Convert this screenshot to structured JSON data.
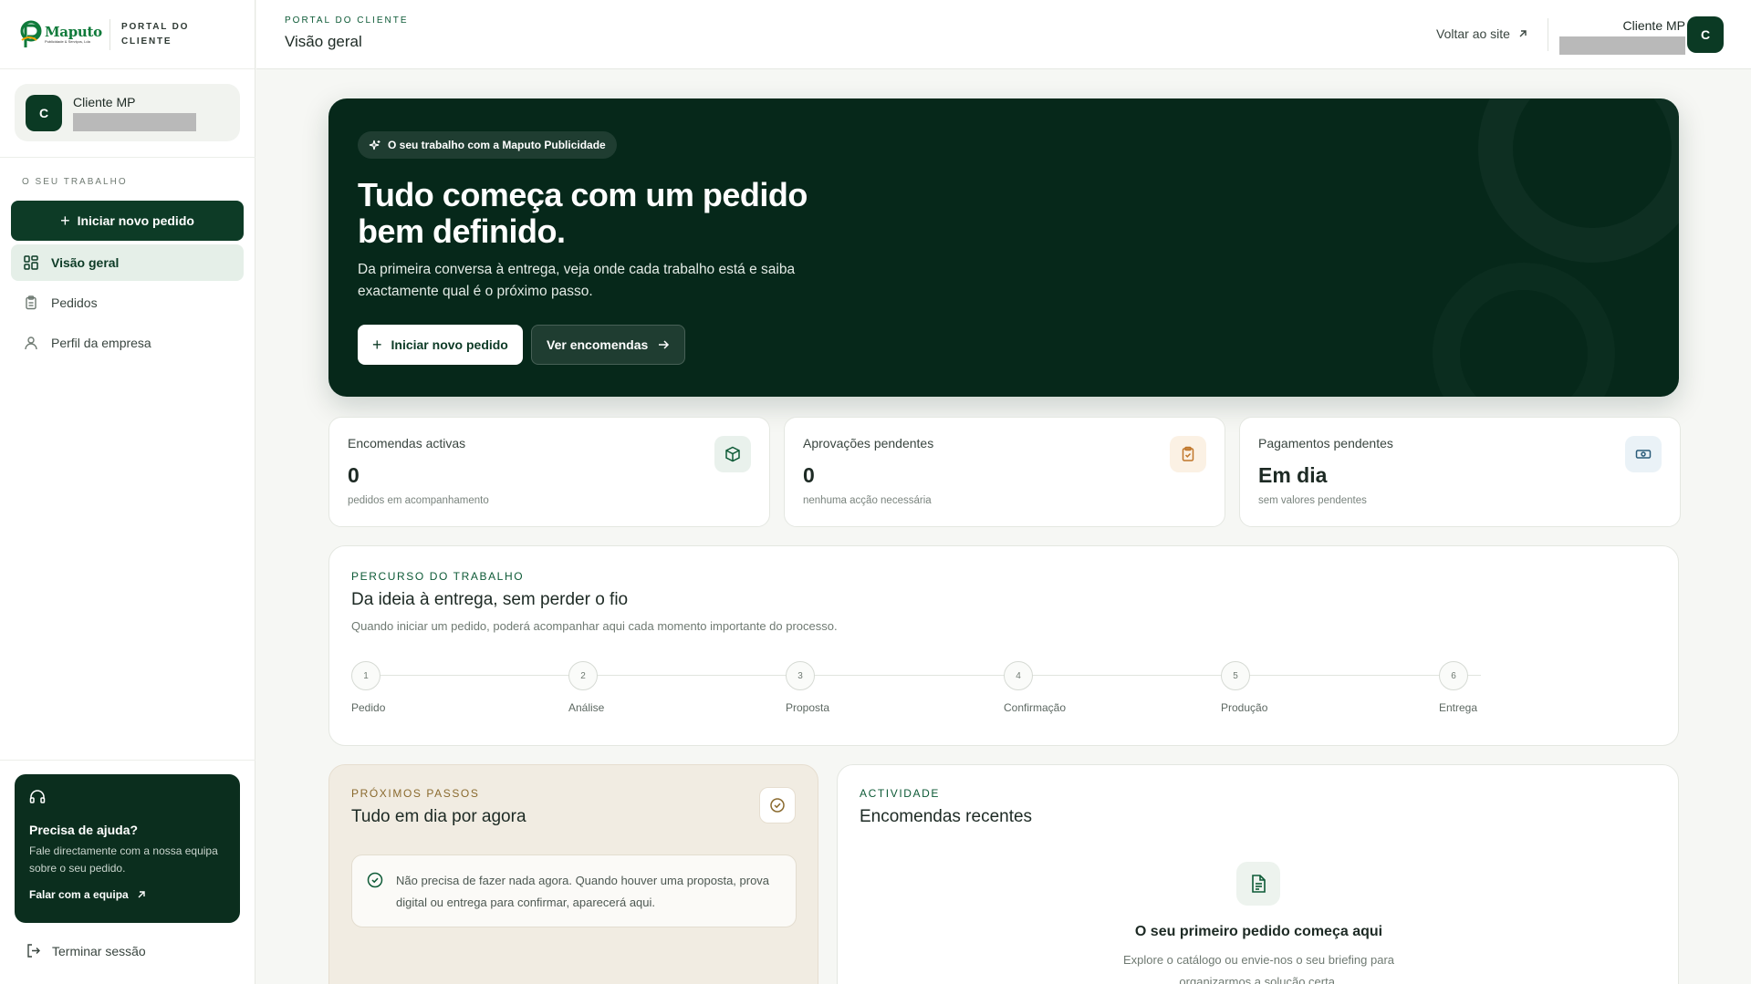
{
  "brand": {
    "logo_word": "Maputo",
    "logo_sub": "Publicidade & Serviços, Lda",
    "portal_line1": "PORTAL DO",
    "portal_line2": "CLIENTE"
  },
  "sidebar": {
    "user": {
      "initial": "C",
      "name": "Cliente MP"
    },
    "section_label": "O SEU TRABALHO",
    "new_order": "Iniciar novo pedido",
    "items": [
      {
        "label": "Visão geral",
        "icon": "grid-icon",
        "active": true
      },
      {
        "label": "Pedidos",
        "icon": "clipboard-icon",
        "active": false
      },
      {
        "label": "Perfil da empresa",
        "icon": "user-icon",
        "active": false
      }
    ],
    "help": {
      "title": "Precisa de ajuda?",
      "text": "Fale directamente com a nossa equipa sobre o seu pedido.",
      "link": "Falar com a equipa"
    },
    "logout": "Terminar sessão"
  },
  "topbar": {
    "eyebrow": "PORTAL DO CLIENTE",
    "title": "Visão geral",
    "back_link": "Voltar ao site",
    "user_name": "Cliente MP",
    "avatar_initial": "C"
  },
  "hero": {
    "chip": "O seu trabalho com a Maputo Publicidade",
    "title": "Tudo começa com um pedido bem definido.",
    "text": "Da primeira conversa à entrega, veja onde cada trabalho está e saiba exactamente qual é o próximo passo.",
    "primary_button": "Iniciar novo pedido",
    "secondary_button": "Ver encomendas"
  },
  "stats": [
    {
      "label": "Encomendas activas",
      "value": "0",
      "sub": "pedidos em acompanhamento",
      "icon": "box-icon",
      "color": "#0d5a36",
      "bg": "#e9f1ec"
    },
    {
      "label": "Aprovações pendentes",
      "value": "0",
      "sub": "nenhuma acção necessária",
      "icon": "clipboard-check-icon",
      "color": "#c0762a",
      "bg": "#fbf1e4"
    },
    {
      "label": "Pagamentos pendentes",
      "value": "Em dia",
      "sub": "sem valores pendentes",
      "icon": "banknote-icon",
      "color": "#2a5c7a",
      "bg": "#eaf2f7"
    }
  ],
  "journey": {
    "eyebrow": "PERCURSO DO TRABALHO",
    "title": "Da ideia à entrega, sem perder o fio",
    "subtitle": "Quando iniciar um pedido, poderá acompanhar aqui cada momento importante do processo.",
    "steps": [
      {
        "number": "1",
        "label": "Pedido"
      },
      {
        "number": "2",
        "label": "Análise"
      },
      {
        "number": "3",
        "label": "Proposta"
      },
      {
        "number": "4",
        "label": "Confirmação"
      },
      {
        "number": "5",
        "label": "Produção"
      },
      {
        "number": "6",
        "label": "Entrega"
      }
    ]
  },
  "next_steps": {
    "eyebrow": "PRÓXIMOS PASSOS",
    "title": "Tudo em dia por agora",
    "message": "Não precisa de fazer nada agora. Quando houver uma proposta, prova digital ou entrega para confirmar, aparecerá aqui."
  },
  "activity": {
    "eyebrow": "ACTIVIDADE",
    "title": "Encomendas recentes",
    "empty_title": "O seu primeiro pedido começa aqui",
    "empty_text": "Explore o catálogo ou envie-nos o seu briefing para organizarmos a solução certa."
  },
  "colors": {
    "primary": "#0d3b26",
    "hero_bg": "#06281a",
    "accent": "#0f7a3a"
  }
}
